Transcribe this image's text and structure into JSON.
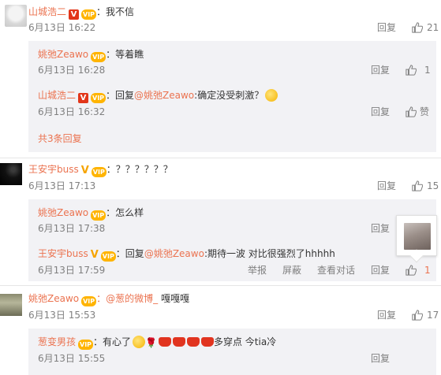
{
  "comments": [
    {
      "user": "山城浩二",
      "text": "：我不信",
      "time": "6月13日 16:22",
      "reply_label": "回复",
      "likes": "21"
    },
    {
      "user": "王安宇buss",
      "text": "：？？？？？？",
      "time": "6月13日 17:13",
      "reply_label": "回复",
      "likes": "15"
    },
    {
      "user": "姚弛Zeawo",
      "text_mention": "：@葱的微博_",
      "text_rest": " 嘎嘎嘎",
      "time": "6月13日 15:53",
      "reply_label": "回复",
      "likes": "17"
    }
  ],
  "replies1": [
    {
      "user": "姚弛Zeawo",
      "text": "：等着瞧",
      "time": "6月13日 16:28",
      "reply_label": "回复",
      "likes": "1"
    },
    {
      "user": "山城浩二",
      "text_pre": "：回复",
      "mention": "@姚弛Zeawo",
      "text": ":确定没受刺激？",
      "time": "6月13日 16:32",
      "reply_label": "回复",
      "likes": "赞"
    }
  ],
  "more_replies": "共3条回复",
  "replies2": [
    {
      "user": "姚弛Zeawo",
      "text": "：怎么样",
      "time": "6月13日 17:38",
      "reply_label": "回复"
    },
    {
      "user": "王安宇buss",
      "text_pre": "：回复",
      "mention": "@姚弛Zeawo",
      "text": ":期待一波 对比很强烈了hhhhh",
      "time": "6月13日 17:59",
      "report": "举报",
      "block": "屏蔽",
      "view_convo": "查看对话",
      "reply_label": "回复",
      "likes": "1"
    }
  ],
  "replies3": [
    {
      "user": "葱变男孩",
      "text": "：有心了",
      "text_end": "多穿点 今tia冷",
      "time": "6月13日 15:55",
      "reply_label": "回复"
    }
  ],
  "badges": {
    "v": "V",
    "vip": "VIP"
  },
  "icons": {
    "like": "thumbs-up-icon"
  },
  "colors": {
    "username": "#eb7350",
    "sub_bg": "#f2f2f5",
    "like_active": "#eb7350",
    "meta": "#808080"
  }
}
